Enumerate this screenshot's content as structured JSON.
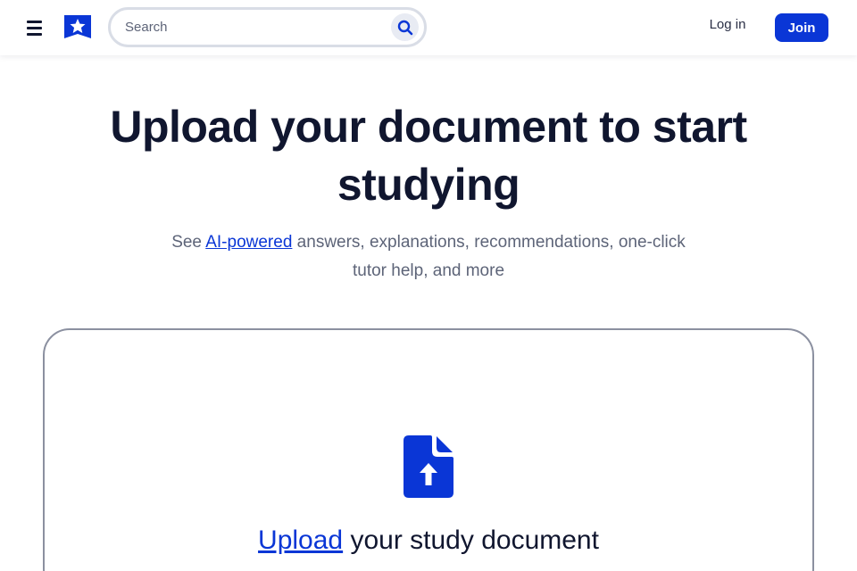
{
  "header": {
    "search_placeholder": "Search",
    "login_label": "Log in",
    "join_label": "Join"
  },
  "hero": {
    "title": "Upload your document to start studying",
    "subtitle_prefix": "See ",
    "subtitle_link": "AI-powered",
    "subtitle_rest": " answers, explanations, recommendations, one-click tutor help, and more"
  },
  "upload": {
    "link_label": "Upload",
    "rest_label": " your study document"
  },
  "icons": {
    "menu": "menu-icon",
    "logo": "logo-icon",
    "search": "search-icon",
    "upload_document": "document-upload-icon"
  },
  "colors": {
    "brand_blue": "#0a36d6",
    "text_dark": "#10162f",
    "text_muted": "#5d6478",
    "card_border": "#8b90a0"
  }
}
